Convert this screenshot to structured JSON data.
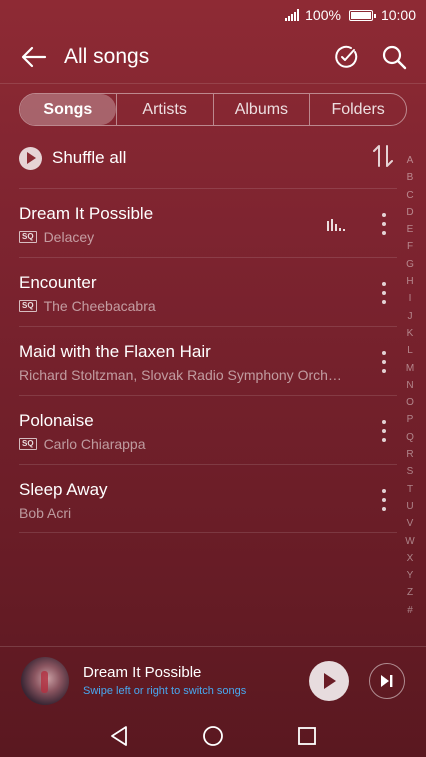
{
  "status_bar": {
    "battery": "100%",
    "time": "10:00"
  },
  "app_bar": {
    "title": "All songs"
  },
  "tabs": [
    {
      "label": "Songs",
      "active": true
    },
    {
      "label": "Artists",
      "active": false
    },
    {
      "label": "Albums",
      "active": false
    },
    {
      "label": "Folders",
      "active": false
    }
  ],
  "shuffle": {
    "label": "Shuffle all"
  },
  "songs": [
    {
      "title": "Dream It Possible",
      "subtitle": "Delacey",
      "sq": true,
      "playing": true
    },
    {
      "title": "Encounter",
      "subtitle": "The Cheebacabra",
      "sq": true,
      "playing": false
    },
    {
      "title": "Maid with the Flaxen Hair",
      "subtitle": "Richard Stoltzman, Slovak Radio Symphony Orch…",
      "sq": false,
      "playing": false
    },
    {
      "title": "Polonaise",
      "subtitle": "Carlo Chiarappa",
      "sq": true,
      "playing": false
    },
    {
      "title": "Sleep Away",
      "subtitle": "Bob Acri",
      "sq": false,
      "playing": false
    }
  ],
  "sq_badge": "SQ",
  "alpha_index": [
    "A",
    "B",
    "C",
    "D",
    "E",
    "F",
    "G",
    "H",
    "I",
    "J",
    "K",
    "L",
    "M",
    "N",
    "O",
    "P",
    "Q",
    "R",
    "S",
    "T",
    "U",
    "V",
    "W",
    "X",
    "Y",
    "Z",
    "#"
  ],
  "now_playing": {
    "title": "Dream It Possible",
    "hint": "Swipe left or right to switch songs"
  },
  "colors": {
    "accent_hint": "#48a8f0",
    "background_top": "#8e2a34",
    "background_bottom": "#5a1820"
  }
}
